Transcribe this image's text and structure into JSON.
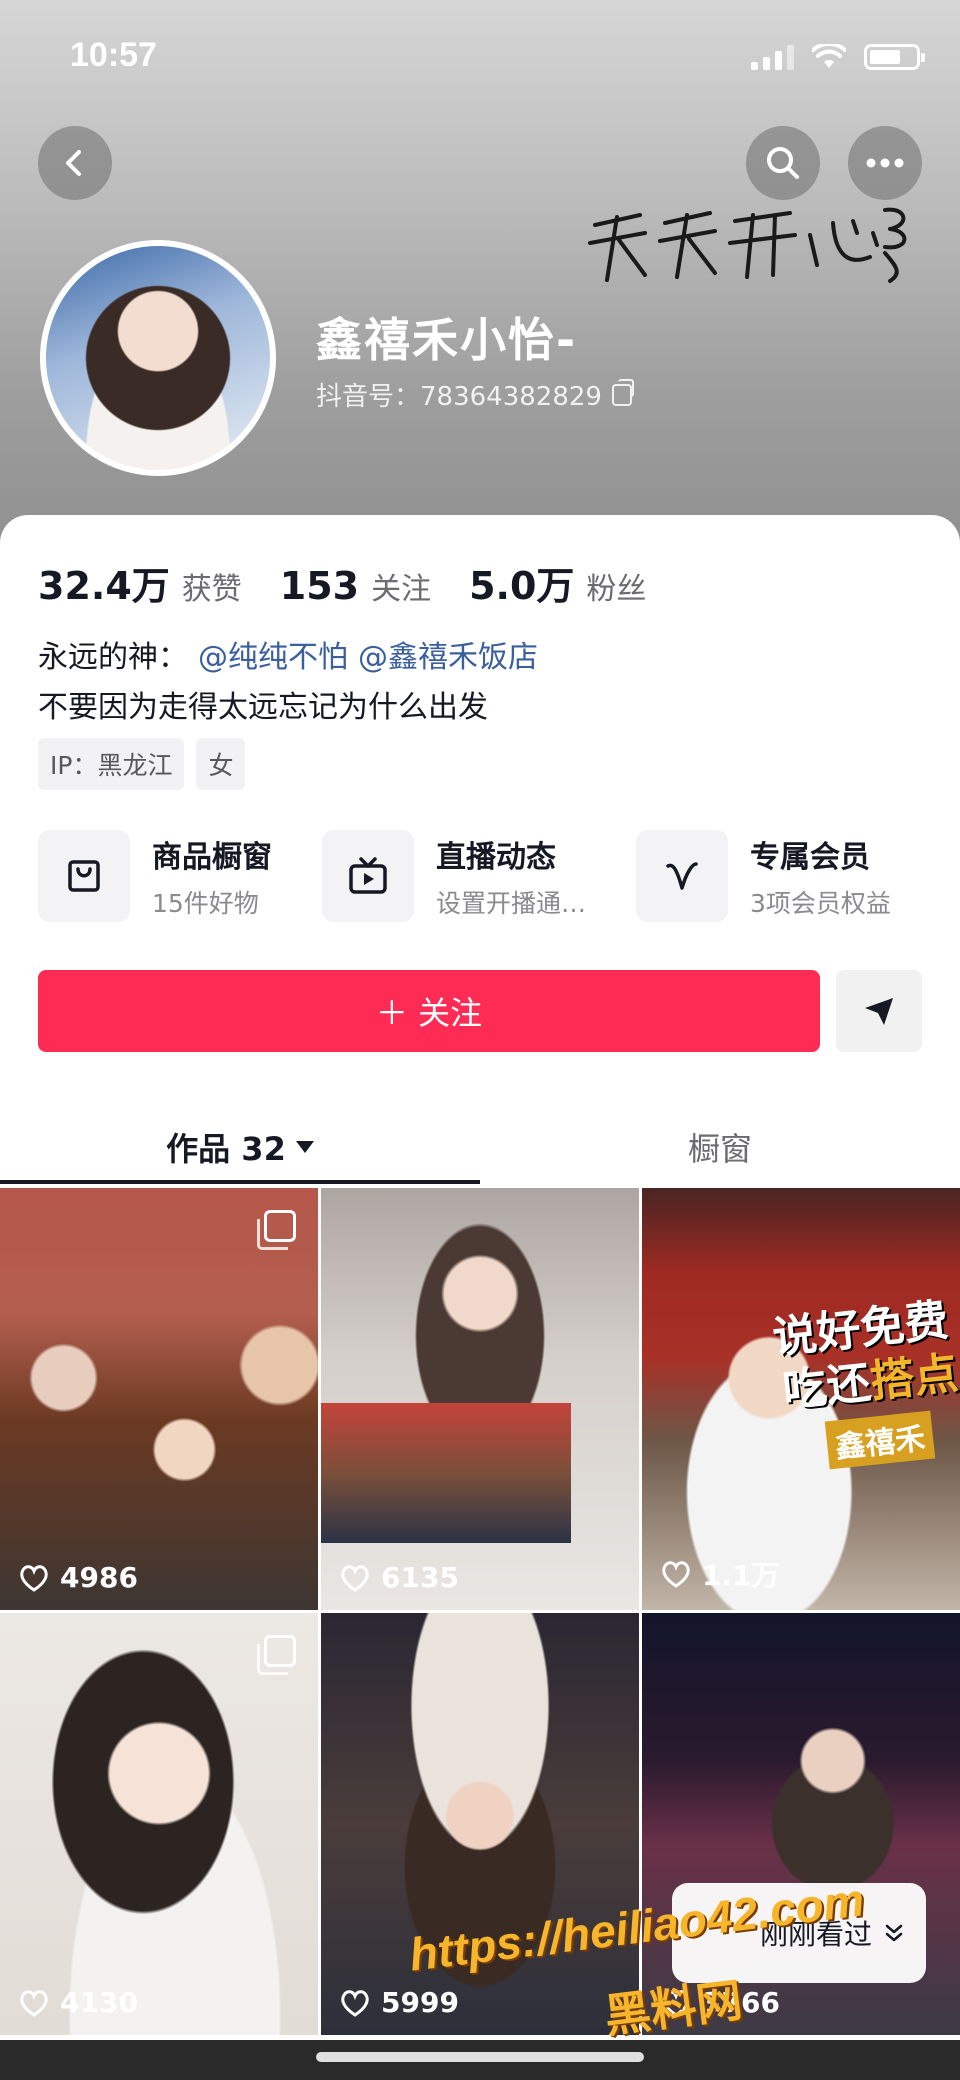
{
  "status_bar": {
    "time": "10:57"
  },
  "profile": {
    "signature_art": "天天开心",
    "nickname": "鑫禧禾小怡-",
    "douyin_id": "抖音号：78364382829"
  },
  "stats": [
    {
      "value": "32.4万",
      "label": "获赞"
    },
    {
      "value": "153",
      "label": "关注"
    },
    {
      "value": "5.0万",
      "label": "粉丝"
    }
  ],
  "bio": {
    "prefix": "永远的神：",
    "mentions": [
      "@纯纯不怕",
      "@鑫禧禾饭店"
    ],
    "line2": "不要因为走得太远忘记为什么出发"
  },
  "tags": [
    "IP：黑龙江",
    "女"
  ],
  "features": [
    {
      "title": "商品橱窗",
      "subtitle": "15件好物",
      "icon": "bag-icon"
    },
    {
      "title": "直播动态",
      "subtitle": "设置开播通…",
      "icon": "tv-icon"
    },
    {
      "title": "专属会员",
      "subtitle": "3项会员权益",
      "icon": "v-badge-icon"
    }
  ],
  "actions": {
    "follow_label": "＋ 关注"
  },
  "tabs": {
    "works_label": "作品 32",
    "showcase_label": "橱窗"
  },
  "videos": [
    {
      "likes": "4986",
      "multi": true
    },
    {
      "likes": "6135",
      "multi": false
    },
    {
      "likes": "1.1万",
      "multi": false,
      "caption1_a": "说好免费",
      "caption1_b": "吃还",
      "caption1_c": "搭点",
      "caption2": "鑫禧禾"
    },
    {
      "likes": "4130",
      "multi": true
    },
    {
      "likes": "5999",
      "multi": false
    },
    {
      "likes": "3766",
      "multi": false,
      "overlay": "刚刚看过"
    }
  ],
  "watermark": {
    "url": "https://heiliao42.com",
    "name": "黑料网"
  },
  "colors": {
    "accent": "#fe2c55",
    "mention": "#3a5f9e"
  }
}
